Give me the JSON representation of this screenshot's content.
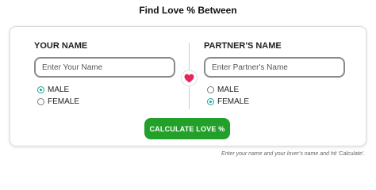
{
  "title": "Find Love % Between",
  "your": {
    "label": "YOUR NAME",
    "placeholder": "Enter Your Name",
    "value": "",
    "gender_options": [
      {
        "label": "MALE",
        "selected": true
      },
      {
        "label": "FEMALE",
        "selected": false
      }
    ]
  },
  "partner": {
    "label": "PARTNER'S NAME",
    "placeholder": "Enter Partner's Name",
    "value": "",
    "gender_options": [
      {
        "label": "MALE",
        "selected": false
      },
      {
        "label": "FEMALE",
        "selected": true
      }
    ]
  },
  "heart_icon": "heart-icon",
  "button_label": "CALCULATE LOVE %",
  "hint": "Enter your name and your lover's name and hit 'Calculate'.",
  "colors": {
    "accent": "#1aa39a",
    "button": "#23a02a",
    "heart": "#e8245b"
  }
}
